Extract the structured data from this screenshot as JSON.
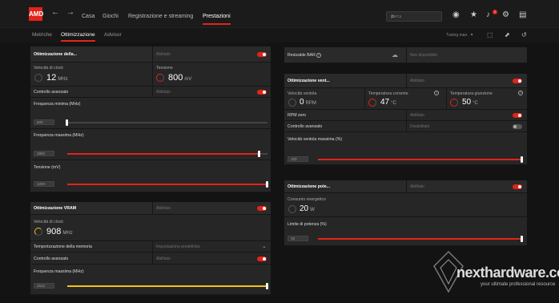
{
  "nav": {
    "logo": "AMD",
    "tabs": [
      "Casa",
      "Giochi",
      "Registrazione e streaming",
      "Prestazioni"
    ],
    "search_placeholder": "Cerca"
  },
  "subnav": {
    "tabs": [
      "Metriche",
      "Ottimizzazione",
      "Advisor"
    ],
    "right_label": "Tuning man."
  },
  "gpu": {
    "title": "Ottimizzazione della...",
    "status": "Abilitato",
    "clock_label": "Velocità di clock",
    "clock_value": "12",
    "clock_unit": "MHz",
    "voltage_label": "Tensione",
    "voltage_value": "800",
    "voltage_unit": "mV",
    "advanced_label": "Controllo avanzato",
    "advanced_status": "Abilitato",
    "min_freq_label": "Frequenza minima (MHz)",
    "min_freq_value": "500",
    "min_freq_pct": 0,
    "max_freq_label": "Frequenza massima (MHz)",
    "max_freq_value": "2850",
    "max_freq_pct": 0.96,
    "voltage_slider_label": "Tensione (mV)",
    "voltage_slider_value": "1200",
    "voltage_slider_pct": 1.0
  },
  "vram": {
    "title": "Ottimizzazione VRAM",
    "status": "Abilitato",
    "clock_label": "Velocità di clock",
    "clock_value": "908",
    "clock_unit": "MHz",
    "timing_label": "Temporizzazione della memoria",
    "timing_value": "Impostazione predefinita",
    "advanced_label": "Controllo avanzato",
    "advanced_status": "Abilitato",
    "max_freq_label": "Frequenza massima (MHz)",
    "max_freq_value": "2512",
    "max_freq_pct": 1.0
  },
  "bar": {
    "label": "Resizable BAR",
    "status": "Non disponibile"
  },
  "fan": {
    "title": "Ottimizzazione vent...",
    "status": "Abilitato",
    "speed_label": "Velocità ventola",
    "speed_value": "0",
    "speed_unit": "RPM",
    "temp_label": "Temperatura corrente",
    "temp_value": "47",
    "temp_unit": "°C",
    "junction_label": "Temperatura giunzione",
    "junction_value": "50",
    "junction_unit": "°C",
    "zero_rpm_label": "RPM zero",
    "zero_rpm_status": "Abilitato",
    "advanced_label": "Controllo avanzato",
    "advanced_status": "Disabilitato",
    "max_speed_label": "Velocità ventola massima (%)",
    "max_speed_value": "100",
    "max_speed_pct": 1.0
  },
  "power": {
    "title": "Ottimizzazione pote...",
    "status": "Abilitato",
    "consumption_label": "Consumo energetico",
    "consumption_value": "20",
    "consumption_unit": "W",
    "limit_label": "Limite di potenza (%)",
    "limit_value": "15",
    "limit_pct": 1.0
  },
  "watermark": {
    "brand": "nexthardware.com",
    "tagline": "your ultimate professional resource"
  },
  "colors": {
    "accent": "#e2231a",
    "vram_accent": "#f0c419"
  }
}
